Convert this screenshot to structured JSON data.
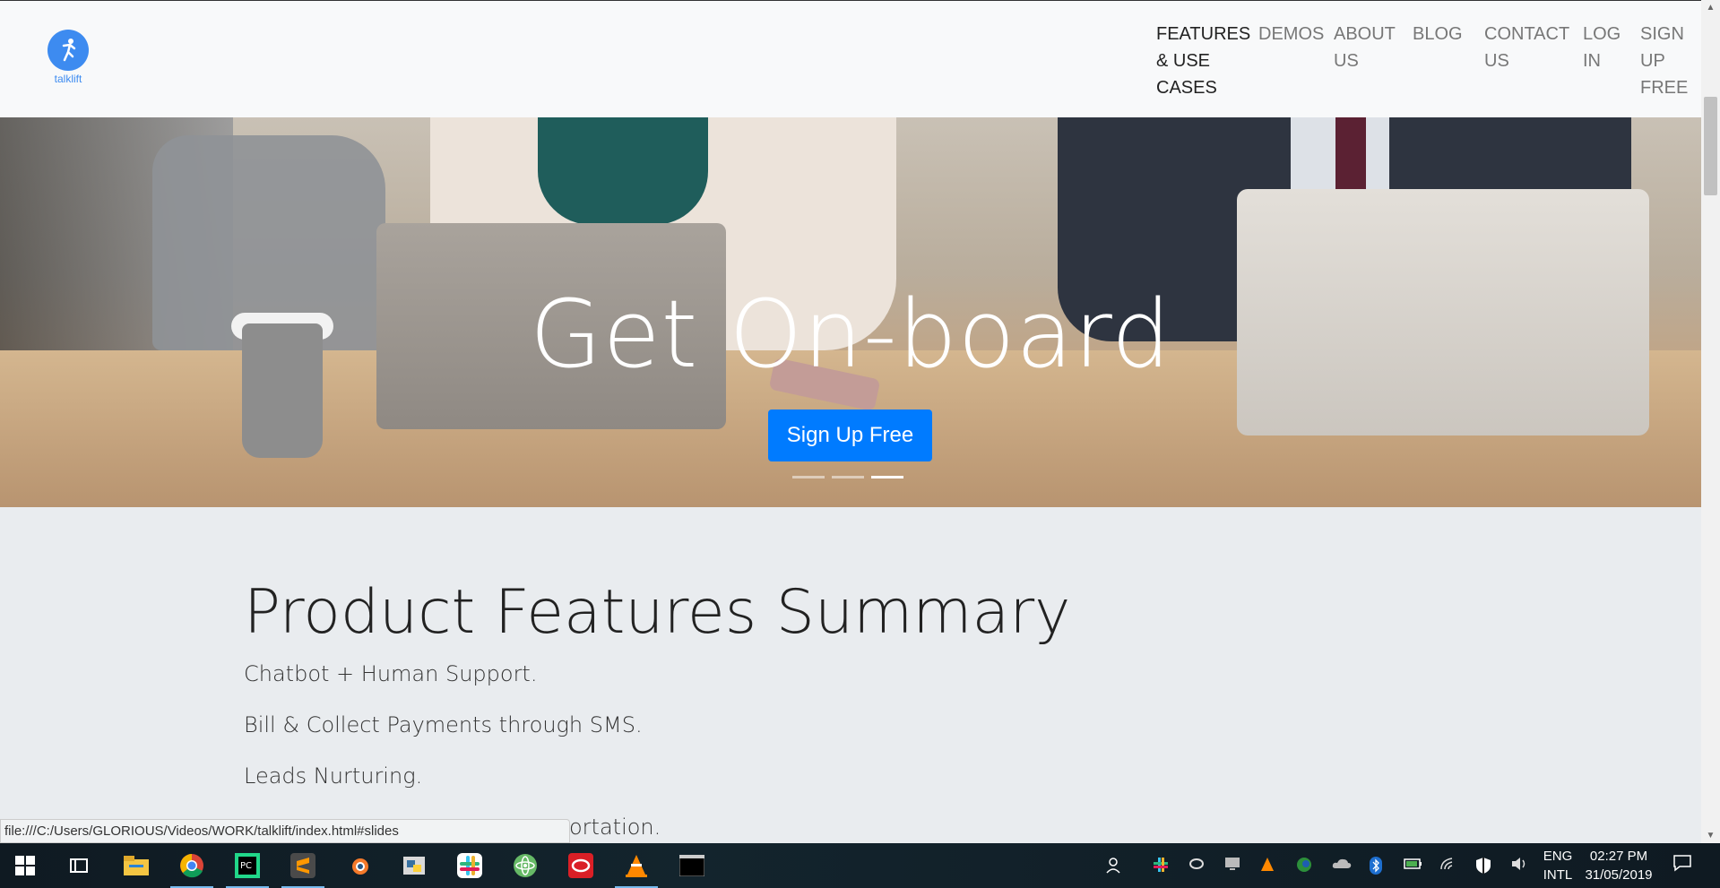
{
  "brand": {
    "logo_text": "talklift"
  },
  "nav": {
    "items": [
      {
        "label": "FEATURES & USE CASES"
      },
      {
        "label": "DEMOS"
      },
      {
        "label": "ABOUT US"
      },
      {
        "label": "BLOG"
      },
      {
        "label": "CONTACT US"
      },
      {
        "label": "LOG IN"
      },
      {
        "label": "SIGN UP FREE"
      }
    ]
  },
  "hero": {
    "title": "Get On-board",
    "button": "Sign Up Free",
    "slides_count": 3,
    "active_slide": 3
  },
  "features": {
    "title": "Product Features Summary",
    "items": [
      "Chatbot + Human Support.",
      "Bill & Collect Payments through SMS.",
      "Leads Nurturing.",
      "ortation."
    ]
  },
  "status_bar": {
    "url": "file:///C:/Users/GLORIOUS/Videos/WORK/talklift/index.html#slides"
  },
  "taskbar": {
    "language_line1": "ENG",
    "language_line2": "INTL",
    "time": "02:27 PM",
    "date": "31/05/2019"
  },
  "colors": {
    "primary": "#007bff",
    "brand": "#3d8bf0",
    "page_bg": "#e9ecef",
    "nav_bg": "#f8f9fa"
  }
}
